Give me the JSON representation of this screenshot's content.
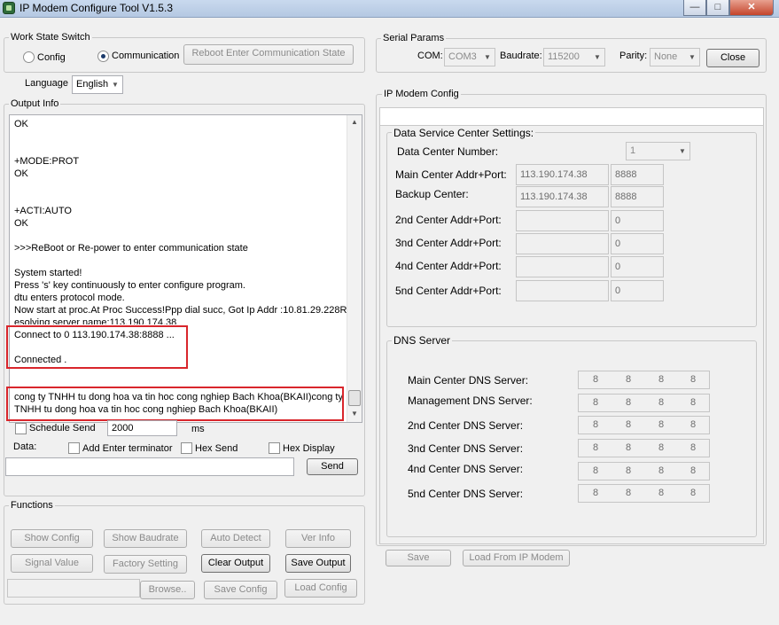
{
  "window": {
    "title": "IP Modem Configure Tool V1.5.3",
    "btn_min": "—",
    "btn_max": "□",
    "btn_close": "✕"
  },
  "work_state": {
    "label": "Work State Switch",
    "config": "Config",
    "communication": "Communication",
    "selected": "communication",
    "reboot": "Reboot Enter Communication State"
  },
  "language": {
    "label": "Language",
    "value": "English"
  },
  "output": {
    "label": "Output Info",
    "lines": [
      "OK",
      "+MODE:PROT",
      "OK",
      "+ACTI:AUTO",
      "OK",
      ">>>ReBoot or Re-power to enter communication state",
      "System started!",
      "Press 's' key continuously to enter configure program.",
      "dtu enters protocol mode.",
      "Now start at proc.At Proc Success!Ppp dial succ, Got Ip Addr :10.81.29.228R",
      "esolving server name:113.190.174.38",
      "Connect to 0 113.190.174.38:8888 ...",
      "Connected .",
      "cong ty TNHH tu dong hoa va tin hoc cong nghiep Bach Khoa(BKAII)cong ty",
      "TNHH tu dong hoa va tin hoc cong nghiep Bach Khoa(BKAII)"
    ]
  },
  "schedule": {
    "label": "Schedule Send",
    "value": "2000",
    "unit": "ms"
  },
  "data": {
    "label": "Data:",
    "add_terminator": "Add Enter terminator",
    "hex_send": "Hex Send",
    "hex_display": "Hex Display",
    "send": "Send",
    "value": ""
  },
  "functions": {
    "label": "Functions",
    "show_config": "Show Config",
    "show_baudrate": "Show Baudrate",
    "auto_detect": "Auto Detect",
    "ver_info": "Ver Info",
    "signal_value": "Signal Value",
    "factory_setting": "Factory Setting",
    "clear_output": "Clear Output",
    "save_output": "Save Output",
    "browse": "Browse..",
    "save_config": "Save Config",
    "load_config": "Load Config"
  },
  "serial": {
    "label": "Serial Params",
    "com_label": "COM:",
    "com": "COM3",
    "baud_label": "Baudrate:",
    "baud": "115200",
    "parity_label": "Parity:",
    "parity": "None",
    "close": "Close"
  },
  "ipmodem": {
    "label": "IP Modem Config",
    "dsc_label": "Data Service Center Settings:",
    "dc_number_label": "Data Center Number:",
    "dc_number": "1",
    "main_label": "Main Center Addr+Port:",
    "main_addr": "113.190.174.38",
    "main_port": "8888",
    "backup_label": "Backup Center:",
    "backup_addr": "113.190.174.38",
    "backup_port": "8888",
    "c2_label": "2nd Center Addr+Port:",
    "c2_port": "0",
    "c3_label": "3nd Center Addr+Port:",
    "c3_port": "0",
    "c4_label": "4nd Center Addr+Port:",
    "c4_port": "0",
    "c5_label": "5nd Center Addr+Port:",
    "c5_port": "0",
    "dns_label": "DNS Server",
    "dns_main_label": "Main Center DNS Server:",
    "dns_mgmt_label": "Management DNS Server:",
    "dns_2_label": "2nd Center DNS Server:",
    "dns_3_label": "3nd Center DNS Server:",
    "dns_4_label": "4nd Center DNS Server:",
    "dns_5_label": "5nd Center DNS Server:",
    "dns_octet": "8",
    "save": "Save",
    "load": "Load From IP Modem"
  },
  "colors": {
    "highlight": "#d9262c",
    "title_bar": "#b4c8e2"
  }
}
